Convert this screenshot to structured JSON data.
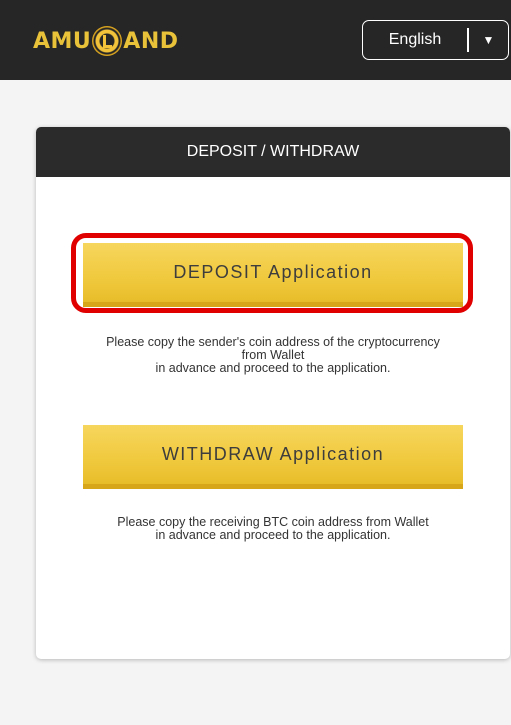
{
  "header": {
    "logo_text_left": "AMU",
    "logo_text_right": "AND",
    "language": {
      "selected": "English",
      "arrow_icon": "caret-down-icon"
    }
  },
  "card": {
    "title": "DEPOSIT / WITHDRAW",
    "deposit": {
      "button_label": "DEPOSIT Application",
      "note_line1": "Please copy the sender's coin address of the cryptocurrency",
      "note_line2": "from Wallet",
      "note_line3": "in advance and proceed to the application."
    },
    "withdraw": {
      "button_label": "WITHDRAW Application",
      "note_line1": "Please copy the receiving BTC coin address from Wallet",
      "note_line2": "in advance and proceed to the application."
    }
  },
  "colors": {
    "header_bg": "#262626",
    "button_gold": "#f0c93d",
    "highlight_red": "#e00000",
    "logo_gold": "#e9c23a"
  }
}
